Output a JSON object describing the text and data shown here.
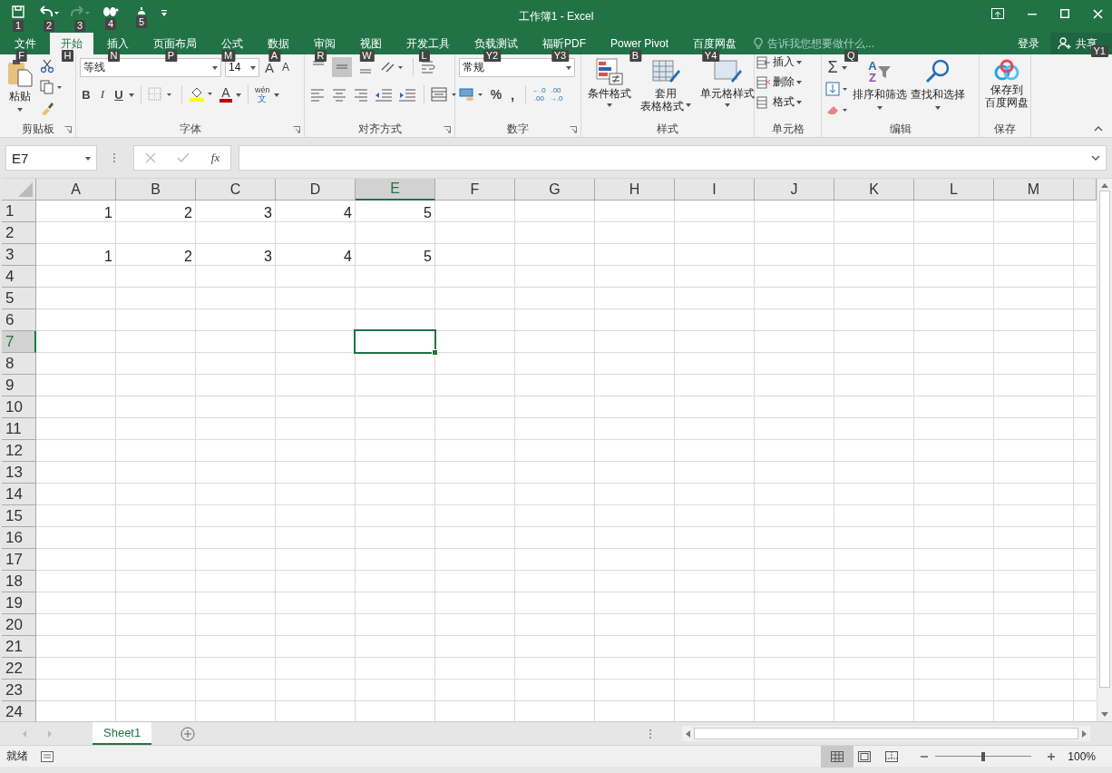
{
  "quick_access": [
    {
      "keytip": "1",
      "disabled": false
    },
    {
      "keytip": "2",
      "disabled": false
    },
    {
      "keytip": "3",
      "disabled": true
    },
    {
      "keytip": "4",
      "disabled": false
    },
    {
      "keytip": "5",
      "disabled": false
    }
  ],
  "title": "工作簿1 - Excel",
  "tabs": [
    {
      "label": "文件",
      "keytip": "F",
      "selected": false
    },
    {
      "label": "开始",
      "keytip": "H",
      "selected": true
    },
    {
      "label": "插入",
      "keytip": "N",
      "selected": false
    },
    {
      "label": "页面布局",
      "keytip": "P",
      "selected": false
    },
    {
      "label": "公式",
      "keytip": "M",
      "selected": false
    },
    {
      "label": "数据",
      "keytip": "A",
      "selected": false
    },
    {
      "label": "审阅",
      "keytip": "R",
      "selected": false
    },
    {
      "label": "视图",
      "keytip": "W",
      "selected": false
    },
    {
      "label": "开发工具",
      "keytip": "L",
      "selected": false
    },
    {
      "label": "负载测试",
      "keytip": "Y2",
      "selected": false
    },
    {
      "label": "福昕PDF",
      "keytip": "Y3",
      "selected": false
    },
    {
      "label": "Power Pivot",
      "keytip": "B",
      "selected": false
    },
    {
      "label": "百度网盘",
      "keytip": "Y4",
      "selected": false
    }
  ],
  "tell_me": {
    "placeholder": "告诉我您想要做什么...",
    "keytip": "Q"
  },
  "account": {
    "sign_in": "登录",
    "share": "共享",
    "share_keytip": "Y1"
  },
  "ribbon": {
    "clipboard": {
      "label": "剪贴板",
      "paste": "粘贴"
    },
    "font": {
      "label": "字体",
      "name": "等线",
      "size": "14",
      "grow": "A",
      "shrink": "A",
      "bold": "B",
      "italic": "I",
      "underline": "U",
      "font_color": "A",
      "phonetic": "wén",
      "phonetic_char": "文"
    },
    "alignment": {
      "label": "对齐方式",
      "vertical": [
        {
          "selected": false
        },
        {
          "selected": true
        },
        {
          "selected": false
        }
      ]
    },
    "number": {
      "label": "数字",
      "format": "常规",
      "percent": "%",
      "comma": ",",
      "increase_decimal": [
        "←.0",
        ".00"
      ],
      "decrease_decimal": [
        ".00",
        "→.0"
      ]
    },
    "styles": {
      "label": "样式",
      "buttons": [
        [
          "条件格式"
        ],
        [
          "套用",
          "表格格式"
        ],
        [
          "单元格样式"
        ]
      ]
    },
    "cells": {
      "label": "单元格",
      "buttons": [
        "插入",
        "删除",
        "格式"
      ]
    },
    "editing": {
      "label": "编辑",
      "sum": "Σ",
      "sort_letters": [
        "A",
        "Z"
      ],
      "buttons": [
        "排序和筛选",
        "查找和选择"
      ]
    },
    "save": {
      "label": "保存",
      "button": [
        "保存到",
        "百度网盘"
      ]
    }
  },
  "formula_bar": {
    "name_box": "E7",
    "fx": "fx"
  },
  "sheet": {
    "columns": [
      {
        "label": "A",
        "selected": false
      },
      {
        "label": "B",
        "selected": false
      },
      {
        "label": "C",
        "selected": false
      },
      {
        "label": "D",
        "selected": false
      },
      {
        "label": "E",
        "selected": true
      },
      {
        "label": "F",
        "selected": false
      },
      {
        "label": "G",
        "selected": false
      },
      {
        "label": "H",
        "selected": false
      },
      {
        "label": "I",
        "selected": false
      },
      {
        "label": "J",
        "selected": false
      },
      {
        "label": "K",
        "selected": false
      },
      {
        "label": "L",
        "selected": false
      },
      {
        "label": "M",
        "selected": false
      }
    ],
    "rows": [
      {
        "label": "1",
        "selected": false,
        "cells": [
          "1",
          "2",
          "3",
          "4",
          "5"
        ]
      },
      {
        "label": "2",
        "selected": false,
        "cells": []
      },
      {
        "label": "3",
        "selected": false,
        "cells": [
          "1",
          "2",
          "3",
          "4",
          "5"
        ]
      },
      {
        "label": "4",
        "selected": false,
        "cells": []
      },
      {
        "label": "5",
        "selected": false,
        "cells": []
      },
      {
        "label": "6",
        "selected": false,
        "cells": []
      },
      {
        "label": "7",
        "selected": true,
        "cells": []
      },
      {
        "label": "8",
        "selected": false,
        "cells": []
      },
      {
        "label": "9",
        "selected": false,
        "cells": []
      },
      {
        "label": "10",
        "selected": false,
        "cells": []
      },
      {
        "label": "11",
        "selected": false,
        "cells": []
      },
      {
        "label": "12",
        "selected": false,
        "cells": []
      },
      {
        "label": "13",
        "selected": false,
        "cells": []
      },
      {
        "label": "14",
        "selected": false,
        "cells": []
      },
      {
        "label": "15",
        "selected": false,
        "cells": []
      },
      {
        "label": "16",
        "selected": false,
        "cells": []
      },
      {
        "label": "17",
        "selected": false,
        "cells": []
      },
      {
        "label": "18",
        "selected": false,
        "cells": []
      },
      {
        "label": "19",
        "selected": false,
        "cells": []
      },
      {
        "label": "20",
        "selected": false,
        "cells": []
      },
      {
        "label": "21",
        "selected": false,
        "cells": []
      },
      {
        "label": "22",
        "selected": false,
        "cells": []
      },
      {
        "label": "23",
        "selected": false,
        "cells": []
      },
      {
        "label": "24",
        "selected": false,
        "cells": []
      }
    ]
  },
  "sheet_tabs": [
    {
      "label": "Sheet1",
      "selected": true
    }
  ],
  "status_bar": {
    "text": "就绪",
    "views": [
      {
        "selected": true
      },
      {
        "selected": false
      },
      {
        "selected": false
      }
    ],
    "zoom": {
      "level": 0.5,
      "text": "100%"
    }
  }
}
